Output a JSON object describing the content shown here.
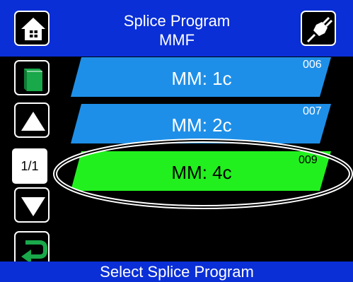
{
  "header": {
    "title_line1": "Splice Program",
    "title_line2": "MMF",
    "home_icon": "home-icon",
    "plugin_icon": "plug-icon"
  },
  "sidebar": {
    "book_icon": "book-icon",
    "up_icon": "triangle-up-icon",
    "page_indicator": "1/1",
    "down_icon": "triangle-down-icon",
    "back_icon": "return-arrow-icon"
  },
  "programs": [
    {
      "label": "MM: 1c",
      "code": "006",
      "color": "#1e8fe8",
      "selected": false
    },
    {
      "label": "MM: 2c",
      "code": "007",
      "color": "#1e8fe8",
      "selected": false
    },
    {
      "label": "MM: 4c",
      "code": "009",
      "color": "#22f01e",
      "selected": true
    }
  ],
  "footer": {
    "status": "Select Splice Program"
  },
  "colors": {
    "bar_blue": "#0a2fd6",
    "item_blue": "#1e8fe8",
    "item_green": "#22f01e",
    "book_green": "#19a84a",
    "background": "#000000"
  }
}
